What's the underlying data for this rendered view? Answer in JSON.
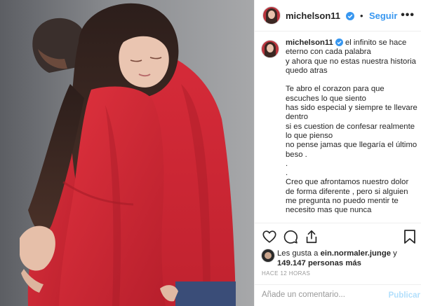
{
  "post": {
    "username": "michelson11",
    "follow_label": "Seguir",
    "more_label": "•••",
    "caption_username": "michelson11",
    "caption": "el infinito se hace eterno con cada palabra\ny ahora que no estas nuestra historia quedo atras\n\nTe abro el corazon para que escuches lo que siento\nhas sido especial y siempre te llevare dentro\nsi es cuestion de confesar realmente lo que pienso\nno pense jamas que llegaría el último beso .\n.\n.\nCreo que afrontamos nuestro dolor de forma diferente , pero si alguien me pregunta no puedo mentir te necesito mas que nunca",
    "likes_prefix": "Les gusta a ",
    "likes_user": "ein.normaler.junge",
    "likes_mid": " y ",
    "likes_count": "149.147 personas más",
    "time_label": "Hace 12 horas",
    "comment_placeholder": "Añade un comentario...",
    "publish_label": "Publicar"
  },
  "icons": [
    "heart-icon",
    "comment-icon",
    "share-icon",
    "bookmark-icon",
    "verified-badge-icon",
    "more-options-icon"
  ],
  "colors": {
    "accent": "#3897f0",
    "verified": "#3897f0",
    "text": "#262626",
    "muted": "#999999",
    "publish_disabled": "#b2dffc"
  }
}
